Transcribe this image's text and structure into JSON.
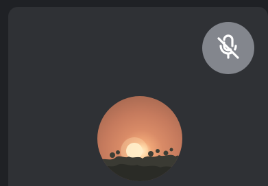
{
  "tile": {
    "participant_name": "",
    "status_icon": "microphone-off-icon",
    "avatar_description_icon": "avatar-image"
  },
  "colors": {
    "background": "#1f2125",
    "tile": "#2f3135",
    "mute_badge": "#83868d",
    "mute_icon": "#ffffff"
  }
}
